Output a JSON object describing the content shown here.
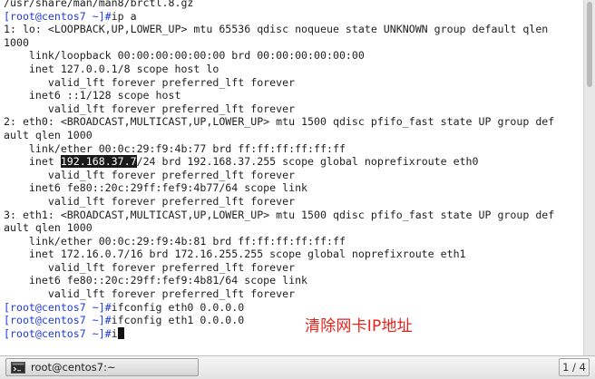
{
  "terminal": {
    "lines": [
      {
        "text": "/usr/share/man/man8/brctl.8.gz"
      },
      {
        "prompt": "[root@centos7 ~]#",
        "text": "ip a"
      },
      {
        "text": "1: lo: <LOOPBACK,UP,LOWER_UP> mtu 65536 qdisc noqueue state UNKNOWN group default qlen"
      },
      {
        "text": "1000"
      },
      {
        "text": "    link/loopback 00:00:00:00:00:00 brd 00:00:00:00:00:00"
      },
      {
        "text": "    inet 127.0.0.1/8 scope host lo"
      },
      {
        "text": "       valid_lft forever preferred_lft forever"
      },
      {
        "text": "    inet6 ::1/128 scope host"
      },
      {
        "text": "       valid_lft forever preferred_lft forever"
      },
      {
        "text": "2: eth0: <BROADCAST,MULTICAST,UP,LOWER_UP> mtu 1500 qdisc pfifo_fast state UP group def"
      },
      {
        "text": "ault qlen 1000"
      },
      {
        "text": "    link/ether 00:0c:29:f9:4b:77 brd ff:ff:ff:ff:ff:ff"
      },
      {
        "pre": "    inet ",
        "highlight": "192.168.37.7",
        "text": "/24 brd 192.168.37.255 scope global noprefixroute eth0"
      },
      {
        "text": "       valid_lft forever preferred_lft forever"
      },
      {
        "text": "    inet6 fe80::20c:29ff:fef9:4b77/64 scope link"
      },
      {
        "text": "       valid_lft forever preferred_lft forever"
      },
      {
        "text": "3: eth1: <BROADCAST,MULTICAST,UP,LOWER_UP> mtu 1500 qdisc pfifo_fast state UP group def"
      },
      {
        "text": "ault qlen 1000"
      },
      {
        "text": "    link/ether 00:0c:29:f9:4b:81 brd ff:ff:ff:ff:ff:ff"
      },
      {
        "text": "    inet 172.16.0.7/16 brd 172.16.255.255 scope global noprefixroute eth1"
      },
      {
        "text": "       valid_lft forever preferred_lft forever"
      },
      {
        "text": "    inet6 fe80::20c:29ff:fef9:4b81/64 scope link"
      },
      {
        "text": "       valid_lft forever preferred_lft forever"
      },
      {
        "prompt": "[root@centos7 ~]#",
        "text": "ifconfig eth0 0.0.0.0"
      },
      {
        "prompt": "[root@centos7 ~]#",
        "text": "ifconfig eth1 0.0.0.0"
      },
      {
        "prompt": "[root@centos7 ~]#",
        "text": "i",
        "cursor": true
      }
    ]
  },
  "annotation": "清除网卡IP地址",
  "taskbar": {
    "task_label": "root@centos7:~",
    "task_icon": "terminal-icon",
    "pager_label": "1 / 4"
  },
  "colors": {
    "prompt": "#1f3bd6",
    "annotation": "#e8221a",
    "highlight_bg": "#1a1a1a"
  }
}
